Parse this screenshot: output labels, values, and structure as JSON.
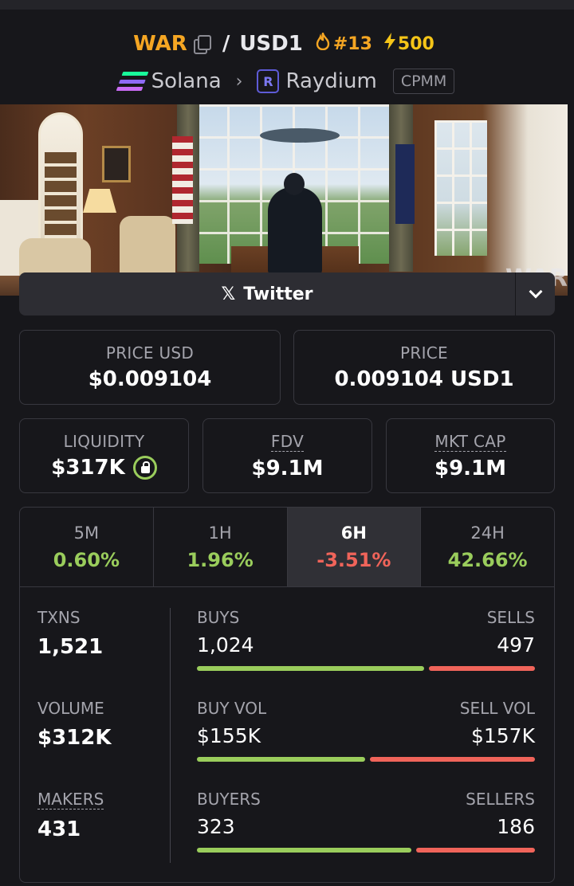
{
  "header": {
    "base_symbol": "WAR",
    "quote_symbol": "USD1",
    "rank": "#13",
    "boosts": "500",
    "chain": "Solana",
    "dex": "Raydium",
    "pool_type": "CPMM"
  },
  "banner": {
    "overlay_text": "WAR"
  },
  "social": {
    "label": "Twitter"
  },
  "price_usd": {
    "label": "PRICE USD",
    "value": "$0.009104"
  },
  "price": {
    "label": "PRICE",
    "value": "0.009104 USD1"
  },
  "liquidity": {
    "label": "LIQUIDITY",
    "value": "$317K"
  },
  "fdv": {
    "label": "FDV",
    "value": "$9.1M"
  },
  "mkt_cap": {
    "label": "MKT CAP",
    "value": "$9.1M"
  },
  "timeframes": [
    {
      "label": "5M",
      "change": "0.60%"
    },
    {
      "label": "1H",
      "change": "1.96%"
    },
    {
      "label": "6H",
      "change": "-3.51%"
    },
    {
      "label": "24H",
      "change": "42.66%"
    }
  ],
  "active_timeframe": "6H",
  "stats": {
    "txns": {
      "label": "TXNS",
      "value": "1,521"
    },
    "volume": {
      "label": "VOLUME",
      "value": "$312K"
    },
    "makers": {
      "label": "MAKERS",
      "value": "431"
    },
    "buys": {
      "label": "BUYS",
      "value": "1,024",
      "ratio": 0.673
    },
    "sells": {
      "label": "SELLS",
      "value": "497"
    },
    "buy_vol": {
      "label": "BUY VOL",
      "value": "$155K",
      "ratio": 0.497
    },
    "sell_vol": {
      "label": "SELL VOL",
      "value": "$157K"
    },
    "buyers": {
      "label": "BUYERS",
      "value": "323",
      "ratio": 0.635
    },
    "sellers": {
      "label": "SELLERS",
      "value": "186"
    }
  },
  "colors": {
    "positive": "#9acd5c",
    "negative": "#f0645a",
    "accent": "#f5a623",
    "background": "#17171b"
  }
}
